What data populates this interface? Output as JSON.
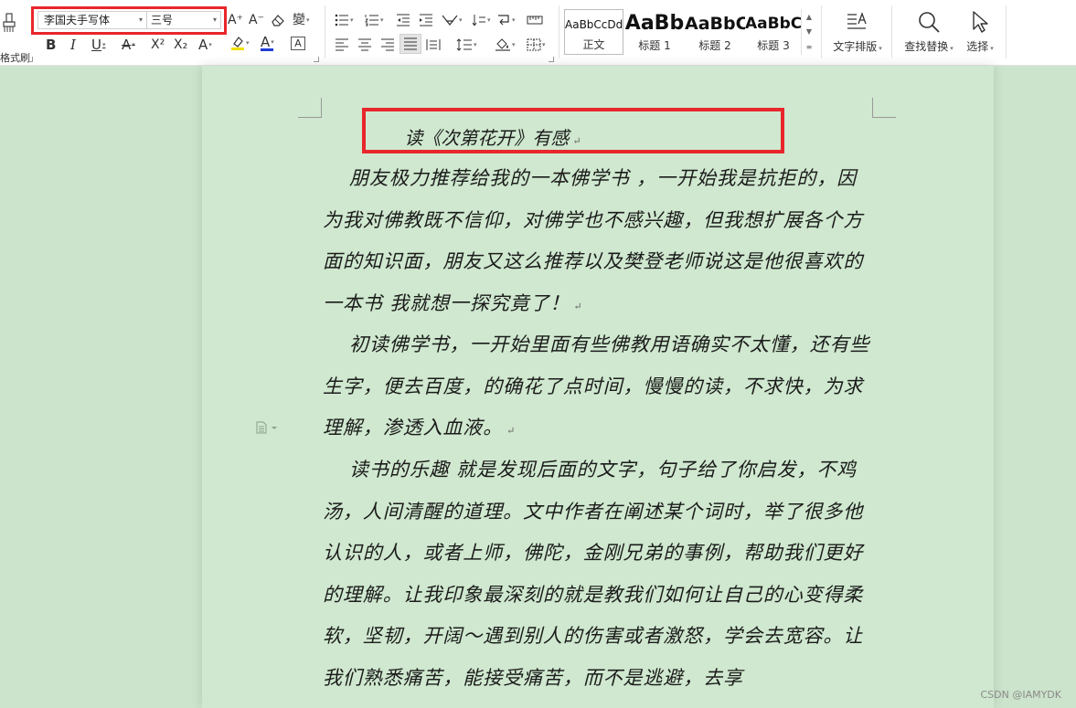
{
  "toolbar": {
    "format_painter_label": "格式刷",
    "font_name": "李国夫手写体",
    "font_size": "三号",
    "styles": [
      {
        "sample": "AaBbCcDd",
        "name": "正文"
      },
      {
        "sample": "AaBb",
        "name": "标题 1"
      },
      {
        "sample": "AaBbC",
        "name": "标题 2"
      },
      {
        "sample": "AaBbC",
        "name": "标题 3"
      }
    ],
    "text_layout_label": "文字排版",
    "find_replace_label": "查找替换",
    "select_label": "选择",
    "glyphs": {
      "bold": "B",
      "italic": "I",
      "underline": "U",
      "strikethrough": "A",
      "superscript": "X²",
      "subscript": "X₂",
      "text_effect": "A",
      "font_color": "A",
      "char_border": "A",
      "grow_font": "A⁺",
      "shrink_font": "A⁻",
      "phonetic": "變"
    }
  },
  "document": {
    "title": "读《次第花开》有感",
    "paragraphs": [
      "朋友极力推荐给我的一本佛学书 ，一开始我是抗拒的，因为我对佛教既不信仰，对佛学也不感兴趣，但我想扩展各个方面的知识面，朋友又这么推荐以及樊登老师说这是他很喜欢的一本书 我就想一探究竟了！",
      "初读佛学书，一开始里面有些佛教用语确实不太懂，还有些生字，便去百度，的确花了点时间，慢慢的读，不求快，为求理解，渗透入血液。",
      "读书的乐趣 就是发现后面的文字，句子给了你启发，不鸡汤，人间清醒的道理。文中作者在阐述某个词时，举了很多他认识的人，或者上师，佛陀，金刚兄弟的事例，帮助我们更好的理解。让我印象最深刻的就是教我们如何让自己的心变得柔软，坚韧，开阔～遇到别人的伤害或者激怒，学会去宽容。让我们熟悉痛苦，能接受痛苦，而不是逃避，去享"
    ],
    "paragraph_mark": "↵"
  },
  "watermark": "CSDN @IAMYDK",
  "colors": {
    "highlight_box": "#e8262b",
    "page_bg": "#cfe8cf",
    "desk_bg": "#cce4cc",
    "font_color_bar": "#1f3bd6",
    "highlighter_bar": "#f0e000"
  }
}
